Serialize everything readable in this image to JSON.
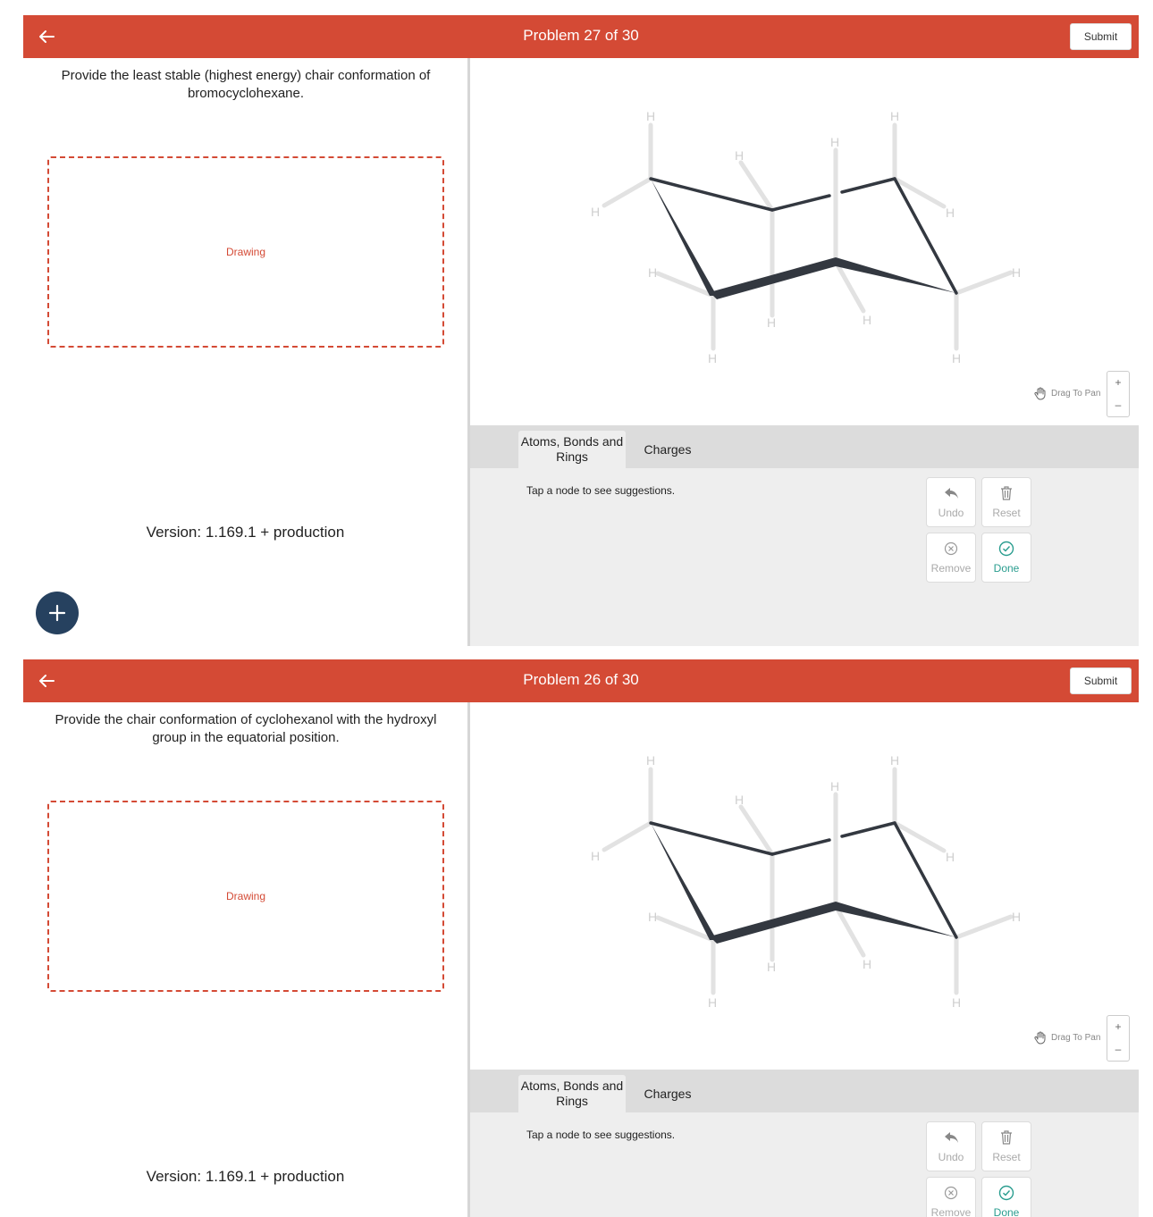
{
  "problems": [
    {
      "title": "Problem 27 of 30",
      "submit_label": "Submit",
      "question": "Provide the least stable (highest energy) chair conformation of bromocyclohexane.",
      "drawing_label": "Drawing",
      "version": "Version: 1.169.1 +  production",
      "atom_label": "H",
      "drag_label": "Drag To Pan",
      "zoom_in": "+",
      "zoom_out": "–",
      "tabs": [
        "Atoms, Bonds and Rings",
        "Charges"
      ],
      "hint": "Tap a node to see suggestions.",
      "tools": {
        "undo": "Undo",
        "reset": "Reset",
        "remove": "Remove",
        "done": "Done"
      },
      "fab_label": "+"
    },
    {
      "title": "Problem 26 of 30",
      "submit_label": "Submit",
      "question": "Provide the chair conformation of cyclohexanol with the hydroxyl group in the equatorial position.",
      "drawing_label": "Drawing",
      "version": "Version: 1.169.1 +  production",
      "atom_label": "H",
      "drag_label": "Drag To Pan",
      "zoom_in": "+",
      "zoom_out": "–",
      "tabs": [
        "Atoms, Bonds and Rings",
        "Charges"
      ],
      "hint": "Tap a node to see suggestions.",
      "tools": {
        "undo": "Undo",
        "reset": "Reset",
        "remove": "Remove",
        "done": "Done"
      }
    }
  ],
  "colors": {
    "header": "#d44a35",
    "fab": "#26415f",
    "done": "#2a9d8f",
    "bond": "#333840",
    "hydrogen": "#cfcfcf"
  }
}
